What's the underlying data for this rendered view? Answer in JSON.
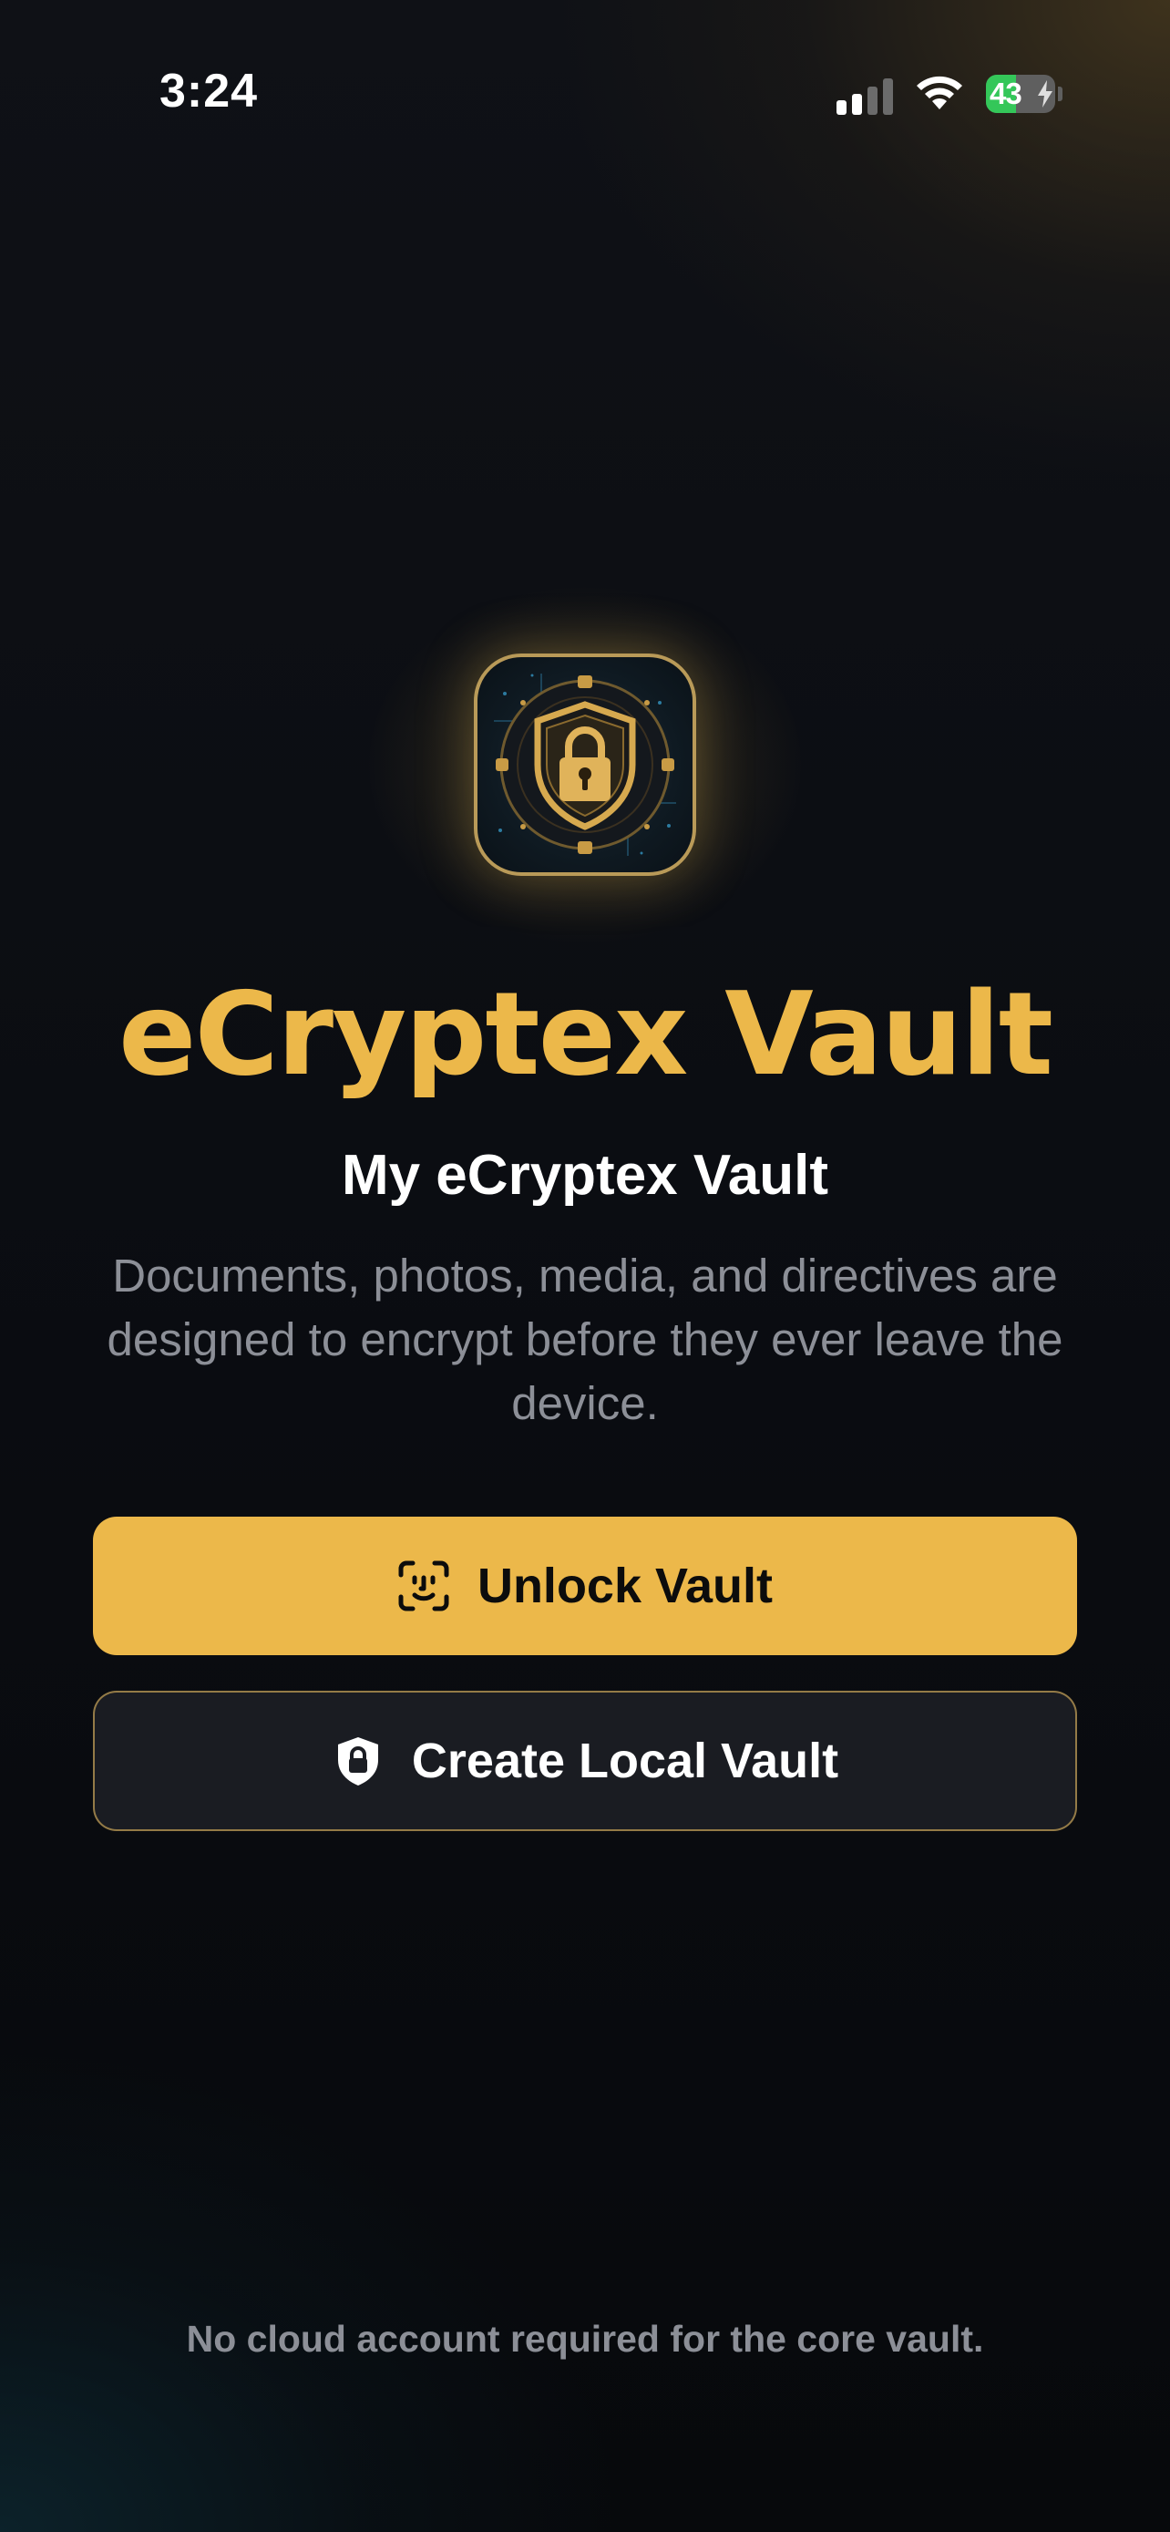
{
  "status_bar": {
    "time": "3:24",
    "battery_level": "43",
    "signal_icon": "cellular-signal-icon",
    "wifi_icon": "wifi-icon",
    "battery_icon": "battery-charging-icon"
  },
  "app": {
    "logo_icon": "shield-padlock-icon",
    "title": "eCryptex Vault",
    "vault_name": "My eCryptex Vault",
    "description": "Documents, photos, media, and directives are designed to encrypt before they ever leave the device."
  },
  "actions": {
    "unlock": {
      "label": "Unlock Vault",
      "icon": "face-id-icon"
    },
    "create": {
      "label": "Create Local Vault",
      "icon": "lock-shield-icon"
    }
  },
  "footer": {
    "note": "No cloud account required for the core vault."
  },
  "colors": {
    "accent_gold": "#ecb84a",
    "background": "#0b0d12",
    "muted_text": "#8c8f97",
    "battery_green": "#34c759"
  }
}
